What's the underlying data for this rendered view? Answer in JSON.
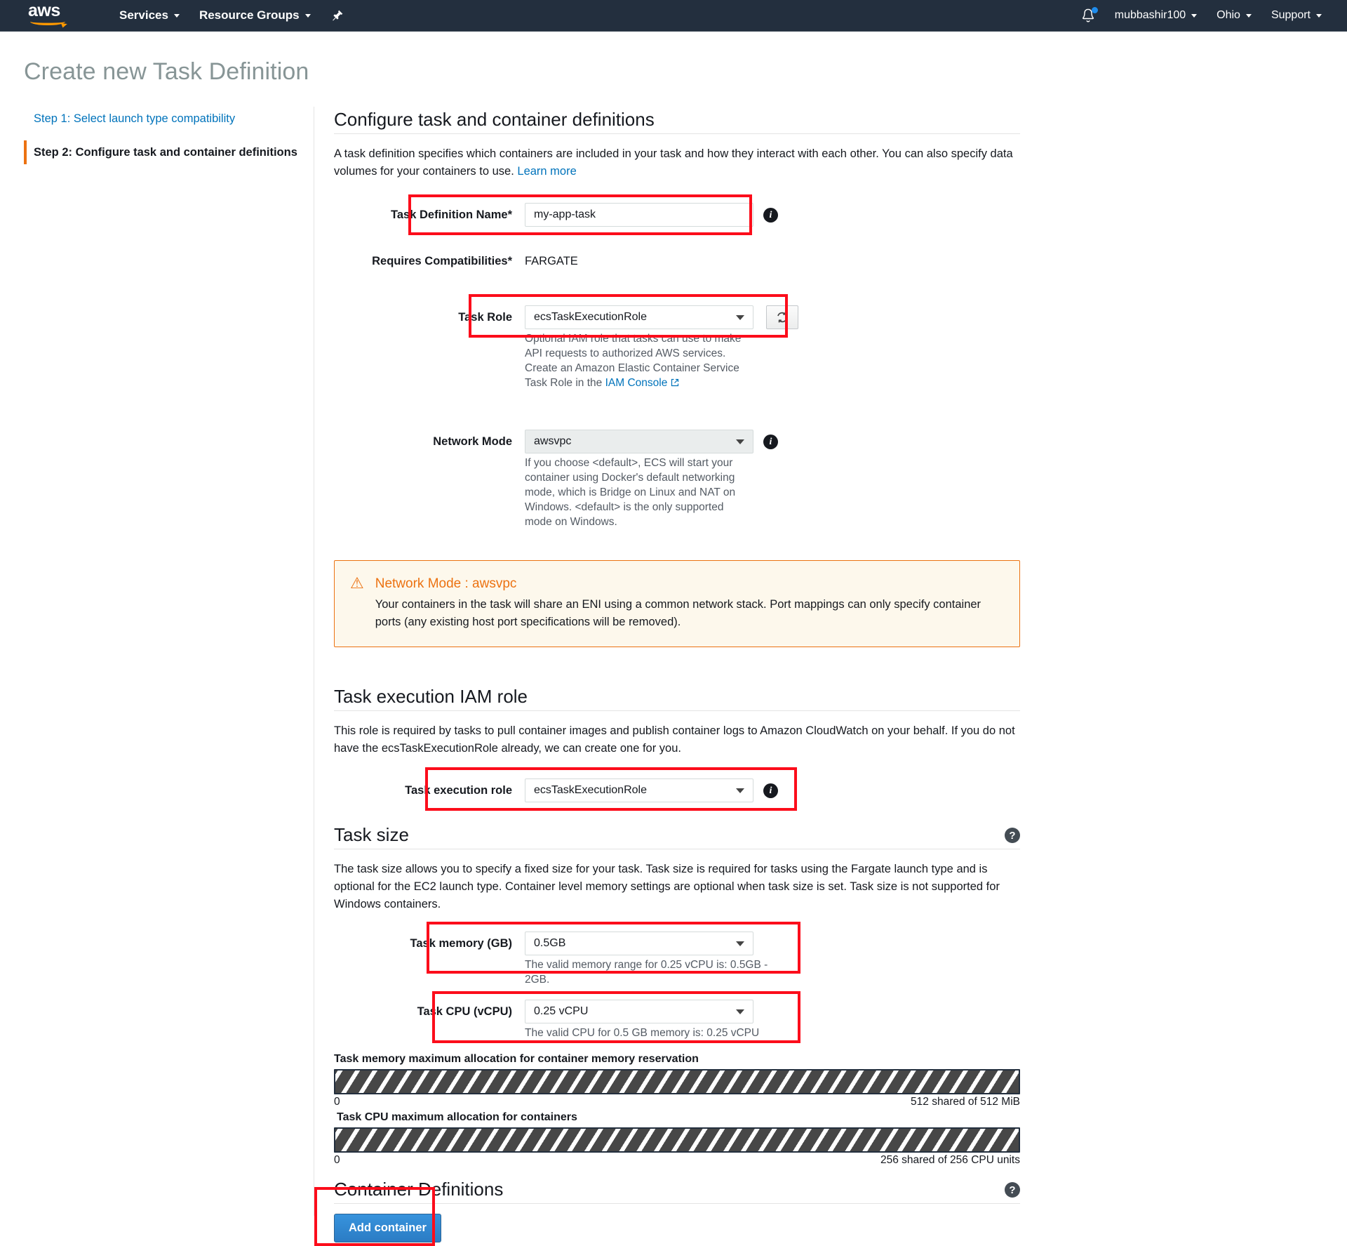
{
  "topnav": {
    "logo_text": "aws",
    "services_label": "Services",
    "resource_groups_label": "Resource Groups",
    "pin_icon": "pin-icon",
    "bell_icon": "bell-icon",
    "account_label": "mubbashir100",
    "region_label": "Ohio",
    "support_label": "Support"
  },
  "page": {
    "title": "Create new Task Definition"
  },
  "sidebar": {
    "steps": [
      {
        "label": "Step 1: Select launch type compatibility",
        "active": false
      },
      {
        "label": "Step 2: Configure task and container definitions",
        "active": true
      }
    ]
  },
  "main": {
    "section_title": "Configure task and container definitions",
    "description": "A task definition specifies which containers are included in your task and how they interact with each other. You can also specify data volumes for your containers to use.",
    "learn_more": "Learn more",
    "task_definition_name": {
      "label": "Task Definition Name*",
      "value": "my-app-task",
      "placeholder": ""
    },
    "requires_compatibilities": {
      "label": "Requires Compatibilities*",
      "value": "FARGATE"
    },
    "task_role": {
      "label": "Task Role",
      "value": "ecsTaskExecutionRole",
      "hint": "Optional IAM role that tasks can use to make API requests to authorized AWS services. Create an Amazon Elastic Container Service Task Role in the",
      "hint_link": "IAM Console",
      "refresh_icon": "refresh-icon"
    },
    "network_mode": {
      "label": "Network Mode",
      "value": "awsvpc",
      "hint": "If you choose <default>, ECS will start your container using Docker's default networking mode, which is Bridge on Linux and NAT on Windows. <default> is the only supported mode on Windows."
    },
    "alert": {
      "icon": "warning-triangle-icon",
      "title": "Network Mode : awsvpc",
      "body": "Your containers in the task will share an ENI using a common network stack. Port mappings can only specify container ports (any existing host port specifications will be removed)."
    },
    "exec_role_section": {
      "title": "Task execution IAM role",
      "description": "This role is required by tasks to pull container images and publish container logs to Amazon CloudWatch on your behalf. If you do not have the ecsTaskExecutionRole already, we can create one for you.",
      "field_label": "Task execution role",
      "field_value": "ecsTaskExecutionRole"
    },
    "task_size_section": {
      "title": "Task size",
      "help_icon": "help-icon",
      "description": "The task size allows you to specify a fixed size for your task. Task size is required for tasks using the Fargate launch type and is optional for the EC2 launch type. Container level memory settings are optional when task size is set. Task size is not supported for Windows containers.",
      "memory_label": "Task memory (GB)",
      "memory_value": "0.5GB",
      "memory_hint": "The valid memory range for 0.25 vCPU is: 0.5GB - 2GB.",
      "cpu_label": "Task CPU (vCPU)",
      "cpu_value": "0.25 vCPU",
      "cpu_hint": "The valid CPU for 0.5 GB memory is: 0.25 vCPU"
    },
    "allocation": {
      "memory_bar_label": "Task memory maximum allocation for container memory reservation",
      "memory_min": "0",
      "memory_max": "512 shared of 512 MiB",
      "cpu_bar_label": "Task CPU maximum allocation for containers",
      "cpu_min": "0",
      "cpu_max": "256 shared of 256 CPU units"
    },
    "container_definitions": {
      "title": "Container Definitions",
      "help_icon": "help-icon",
      "add_button": "Add container"
    }
  },
  "colors": {
    "nav_bg": "#232f3e",
    "accent_orange": "#ec7211",
    "link_blue": "#0073bb",
    "annotation_red": "#fc0d1b",
    "button_blue": "#2b7cc4"
  }
}
